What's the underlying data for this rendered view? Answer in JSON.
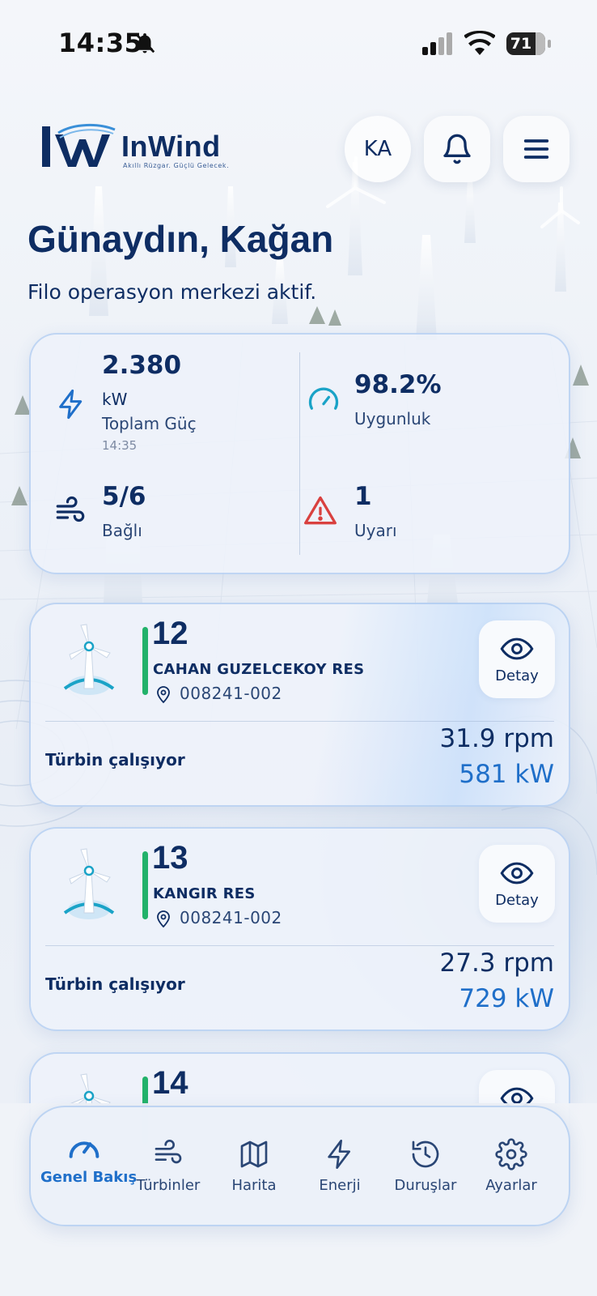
{
  "status_bar": {
    "time": "14:35",
    "battery": "71"
  },
  "brand": {
    "name": "InWind",
    "tagline": "Akıllı Rüzgar. Güçlü Gelecek."
  },
  "header": {
    "avatar_initials": "KA"
  },
  "greeting": {
    "title": "Günaydın, Kağan",
    "subtitle": "Filo operasyon merkezi aktif."
  },
  "stats": {
    "power": {
      "value": "2.380",
      "unit": "kW",
      "label": "Toplam Güç",
      "time": "14:35",
      "icon": "bolt-icon"
    },
    "availability": {
      "value": "98.2%",
      "label": "Uygunluk",
      "icon": "gauge-icon"
    },
    "connected": {
      "value": "5/6",
      "label": "Bağlı",
      "icon": "wind-icon"
    },
    "warnings": {
      "value": "1",
      "label": "Uyarı",
      "icon": "warning-icon"
    }
  },
  "turbines": [
    {
      "id": "12",
      "name": "CAHAN GUZELCEKOY RES",
      "code": "008241-002",
      "detail_label": "Detay",
      "status": "Türbin çalışıyor",
      "rpm": "31.9 rpm",
      "power": "581 kW"
    },
    {
      "id": "13",
      "name": "KANGIR RES",
      "code": "008241-002",
      "detail_label": "Detay",
      "status": "Türbin çalışıyor",
      "rpm": "27.3 rpm",
      "power": "729 kW"
    },
    {
      "id": "14"
    }
  ],
  "nav": {
    "items": [
      {
        "label": "Genel Bakış",
        "icon": "gauge-icon",
        "active": true
      },
      {
        "label": "Türbinler",
        "icon": "wind-icon"
      },
      {
        "label": "Harita",
        "icon": "map-icon"
      },
      {
        "label": "Enerji",
        "icon": "bolt-icon"
      },
      {
        "label": "Duruşlar",
        "icon": "history-icon"
      },
      {
        "label": "Ayarlar",
        "icon": "gear-icon"
      }
    ]
  },
  "colors": {
    "primary": "#0e2d63",
    "accent": "#1f6fc9",
    "ok": "#22b26a",
    "warn": "#d9413f",
    "teal": "#1aa3c7"
  }
}
